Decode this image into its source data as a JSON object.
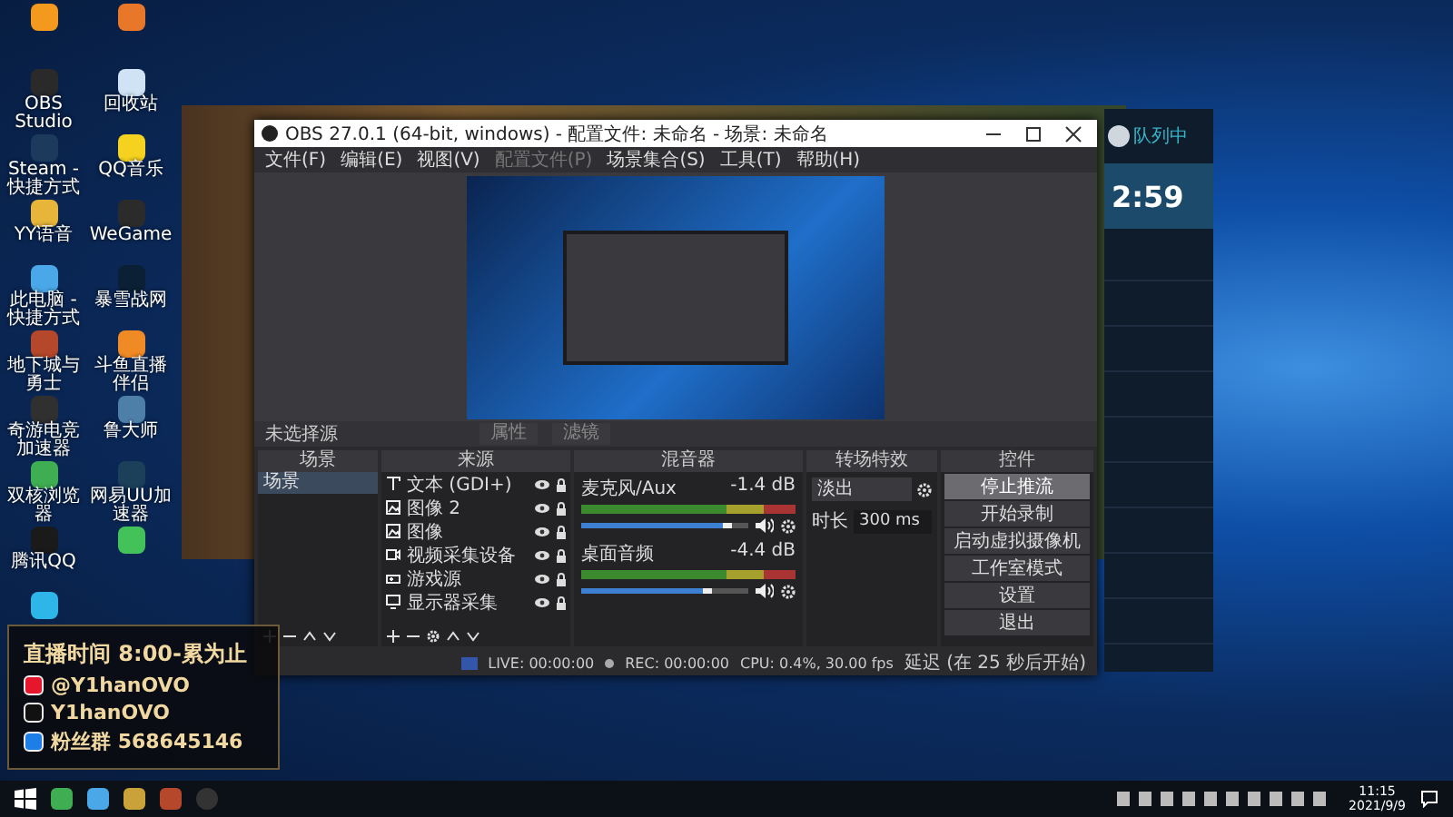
{
  "desktop": {
    "icons": [
      {
        "kind": "douyu"
      },
      {
        "kind": "fish"
      },
      {
        "label": "OBS Studio",
        "kind": "obs"
      },
      {
        "label": "回收站",
        "kind": "bin"
      },
      {
        "label": "Steam - 快捷方式",
        "kind": "steam"
      },
      {
        "label": "QQ音乐",
        "kind": "music"
      },
      {
        "label": "YY语音",
        "kind": "yy"
      },
      {
        "label": "WeGame",
        "kind": "wegame"
      },
      {
        "label": "此电脑 - 快捷方式",
        "kind": "pc"
      },
      {
        "label": "暴雪战网",
        "kind": "battle"
      },
      {
        "label": "地下城与勇士",
        "kind": "dnf"
      },
      {
        "label": "斗鱼直播伴侣",
        "kind": "douyu2"
      },
      {
        "label": "奇游电竞加速器",
        "kind": "qiyou"
      },
      {
        "label": "鲁大师",
        "kind": "lu"
      },
      {
        "label": "双核浏览器",
        "kind": "browser"
      },
      {
        "label": "网易UU加速器",
        "kind": "uu"
      },
      {
        "label": "腾讯QQ",
        "kind": "qq"
      },
      {
        "kind": "wechat"
      },
      {
        "kind": "x"
      }
    ]
  },
  "obs": {
    "title": "OBS 27.0.1 (64-bit, windows) - 配置文件: 未命名 - 场景: 未命名",
    "menu": [
      {
        "label": "文件(F)",
        "disabled": false
      },
      {
        "label": "编辑(E)",
        "disabled": false
      },
      {
        "label": "视图(V)",
        "disabled": false
      },
      {
        "label": "配置文件(P)",
        "disabled": true
      },
      {
        "label": "场景集合(S)",
        "disabled": false
      },
      {
        "label": "工具(T)",
        "disabled": false
      },
      {
        "label": "帮助(H)",
        "disabled": false
      }
    ],
    "context_bar": {
      "label": "未选择源",
      "buttons": [
        "属性",
        "滤镜"
      ]
    },
    "scenes": {
      "title": "场景",
      "items": [
        {
          "label": "场景",
          "selected": true
        }
      ]
    },
    "sources": {
      "title": "来源",
      "items": [
        {
          "label": "文本 (GDI+)",
          "kind": "text"
        },
        {
          "label": "图像 2",
          "kind": "image"
        },
        {
          "label": "图像",
          "kind": "image"
        },
        {
          "label": "视频采集设备",
          "kind": "camera"
        },
        {
          "label": "游戏源",
          "kind": "game"
        },
        {
          "label": "显示器采集",
          "kind": "monitor"
        }
      ]
    },
    "mixer": {
      "title": "混音器",
      "channels": [
        {
          "name": "麦克风/Aux",
          "reading": "-1.4 dB",
          "level": 0.9
        },
        {
          "name": "桌面音频",
          "reading": "-4.4 dB",
          "level": 0.78
        }
      ]
    },
    "transitions": {
      "title": "转场特效",
      "type": "淡出",
      "duration_label": "时长",
      "duration": "300 ms"
    },
    "controls": {
      "title": "控件",
      "buttons": [
        {
          "label": "停止推流",
          "active": true
        },
        {
          "label": "开始录制",
          "active": false
        },
        {
          "label": "启动虚拟摄像机",
          "active": false
        },
        {
          "label": "工作室模式",
          "active": false
        },
        {
          "label": "设置",
          "active": false
        },
        {
          "label": "退出",
          "active": false
        }
      ]
    },
    "status_bar": {
      "live": "LIVE: 00:00:00",
      "rec": "REC: 00:00:00",
      "cpu": "CPU: 0.4%, 30.00 fps",
      "reconnect": "延迟 (在 25 秒后开始)"
    }
  },
  "chat_app": {
    "status": "队列中",
    "timer": "2:59"
  },
  "overlay": {
    "lines": [
      {
        "kind": "clock",
        "text": "直播时间 8:00-累为止"
      },
      {
        "kind": "weibo",
        "text": "@Y1hanOVO"
      },
      {
        "kind": "tiktok",
        "text": "Y1hanOVO"
      },
      {
        "kind": "qq",
        "text": "粉丝群 568645146"
      }
    ]
  },
  "taskbar": {
    "time": "11:15",
    "date": "2021/9/9"
  }
}
